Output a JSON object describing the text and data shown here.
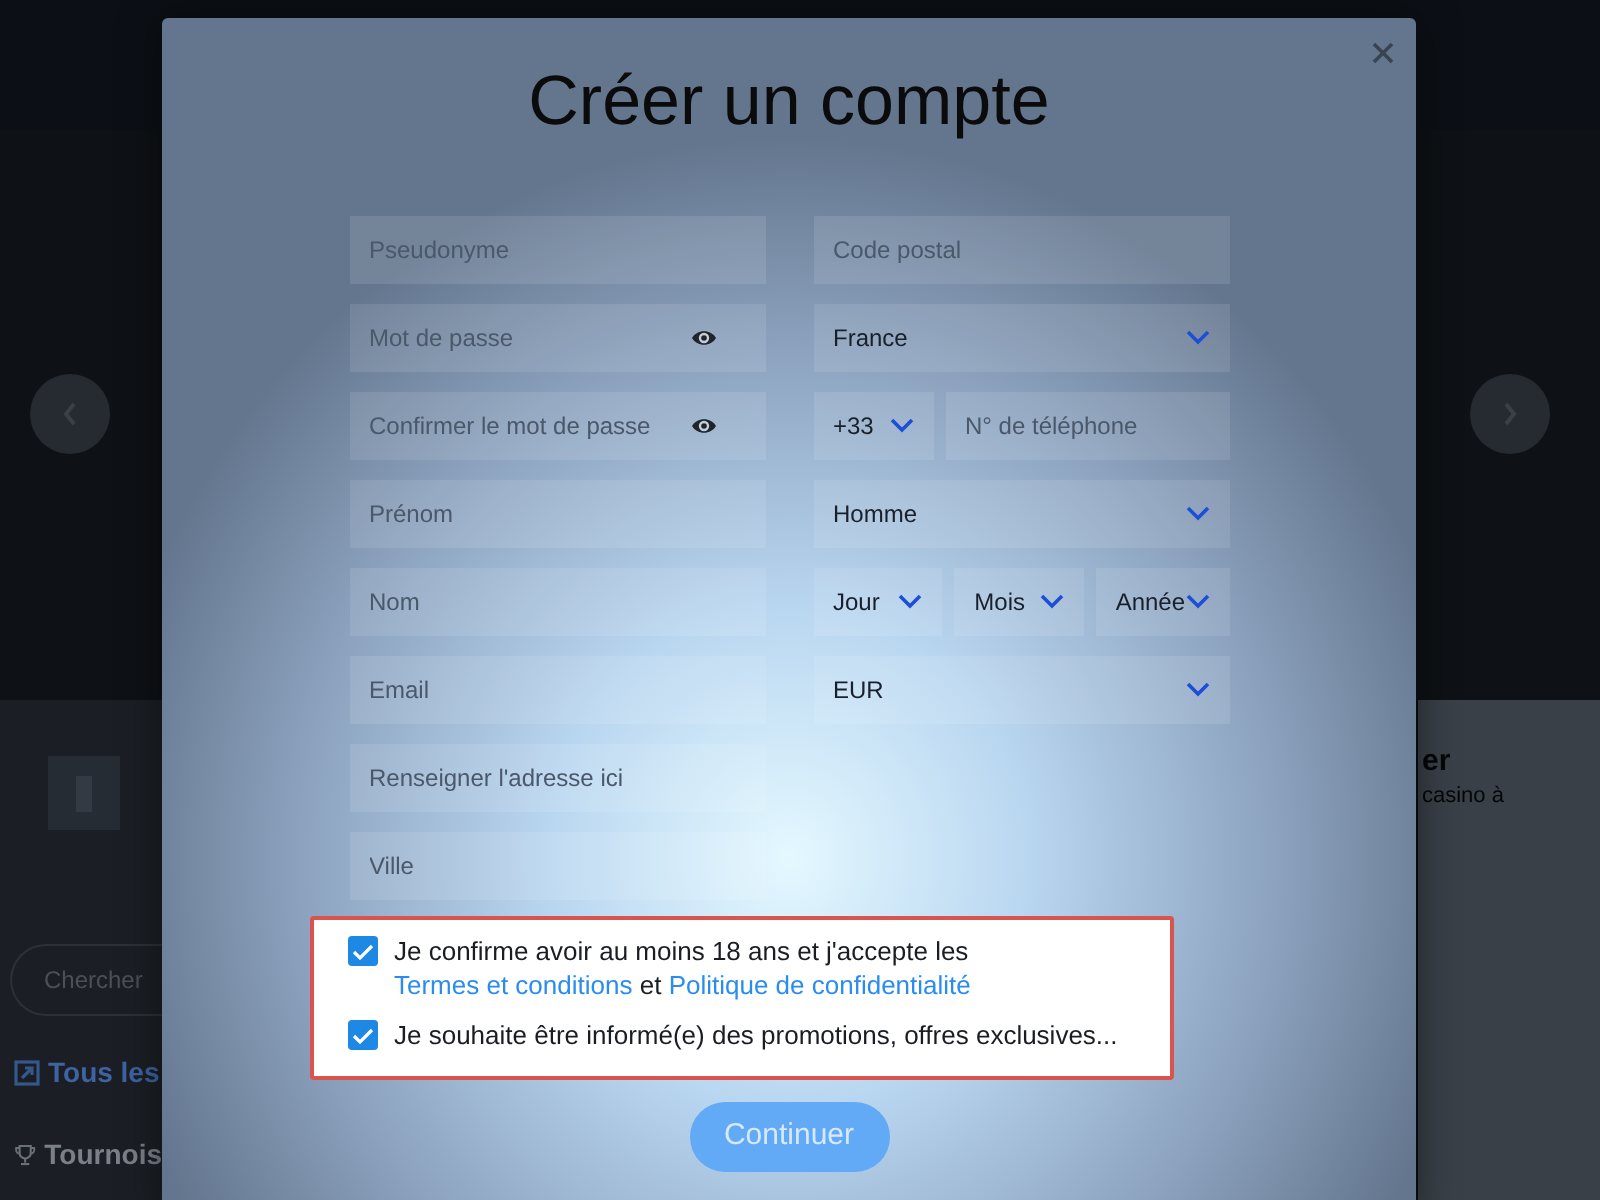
{
  "page": {
    "search_field": {
      "placeholder": "Chercher"
    },
    "sidebar_items": [
      {
        "kind": "games",
        "label": "Tous les"
      },
      {
        "kind": "tournaments",
        "label": "Tournois"
      }
    ],
    "promo": {
      "title": "er",
      "text": "casino à"
    }
  },
  "modal": {
    "title": "Créer un compte",
    "left_fields": [
      {
        "kind": "text",
        "placeholder": "Pseudonyme"
      },
      {
        "kind": "password",
        "placeholder": "Mot de passe"
      },
      {
        "kind": "password",
        "placeholder": "Confirmer le mot de passe"
      },
      {
        "kind": "text",
        "placeholder": "Prénom"
      },
      {
        "kind": "text",
        "placeholder": "Nom"
      },
      {
        "kind": "text",
        "placeholder": "Email"
      },
      {
        "kind": "text",
        "placeholder": "Renseigner l'adresse ici"
      },
      {
        "kind": "text",
        "placeholder": "Ville"
      }
    ],
    "right_rows": [
      [
        {
          "kind": "text",
          "placeholder": "Code postal"
        }
      ],
      [
        {
          "kind": "select",
          "value": "France"
        }
      ],
      [
        {
          "kind": "select",
          "value": "+33"
        },
        {
          "kind": "text",
          "placeholder": "N° de téléphone"
        }
      ],
      [
        {
          "kind": "select",
          "value": "Homme"
        }
      ],
      [
        {
          "kind": "select",
          "value": "Jour"
        },
        {
          "kind": "select",
          "value": "Mois"
        },
        {
          "kind": "select",
          "value": "Année"
        }
      ],
      [
        {
          "kind": "select",
          "value": "EUR"
        }
      ]
    ],
    "checkboxes": [
      {
        "checked": true,
        "parts": [
          {
            "kind": "text",
            "text": "Je confirme avoir au moins 18 ans et j'accepte les"
          },
          {
            "kind": "link",
            "text": "Termes et conditions"
          },
          {
            "kind": "text",
            "text": "et"
          },
          {
            "kind": "link",
            "text": "Politique de confidentialité"
          }
        ]
      },
      {
        "checked": true,
        "parts": [
          {
            "kind": "text",
            "text": "Je souhaite être informé(e) des promotions, offres exclusives..."
          }
        ]
      }
    ],
    "button": {
      "label": "Continuer"
    }
  }
}
